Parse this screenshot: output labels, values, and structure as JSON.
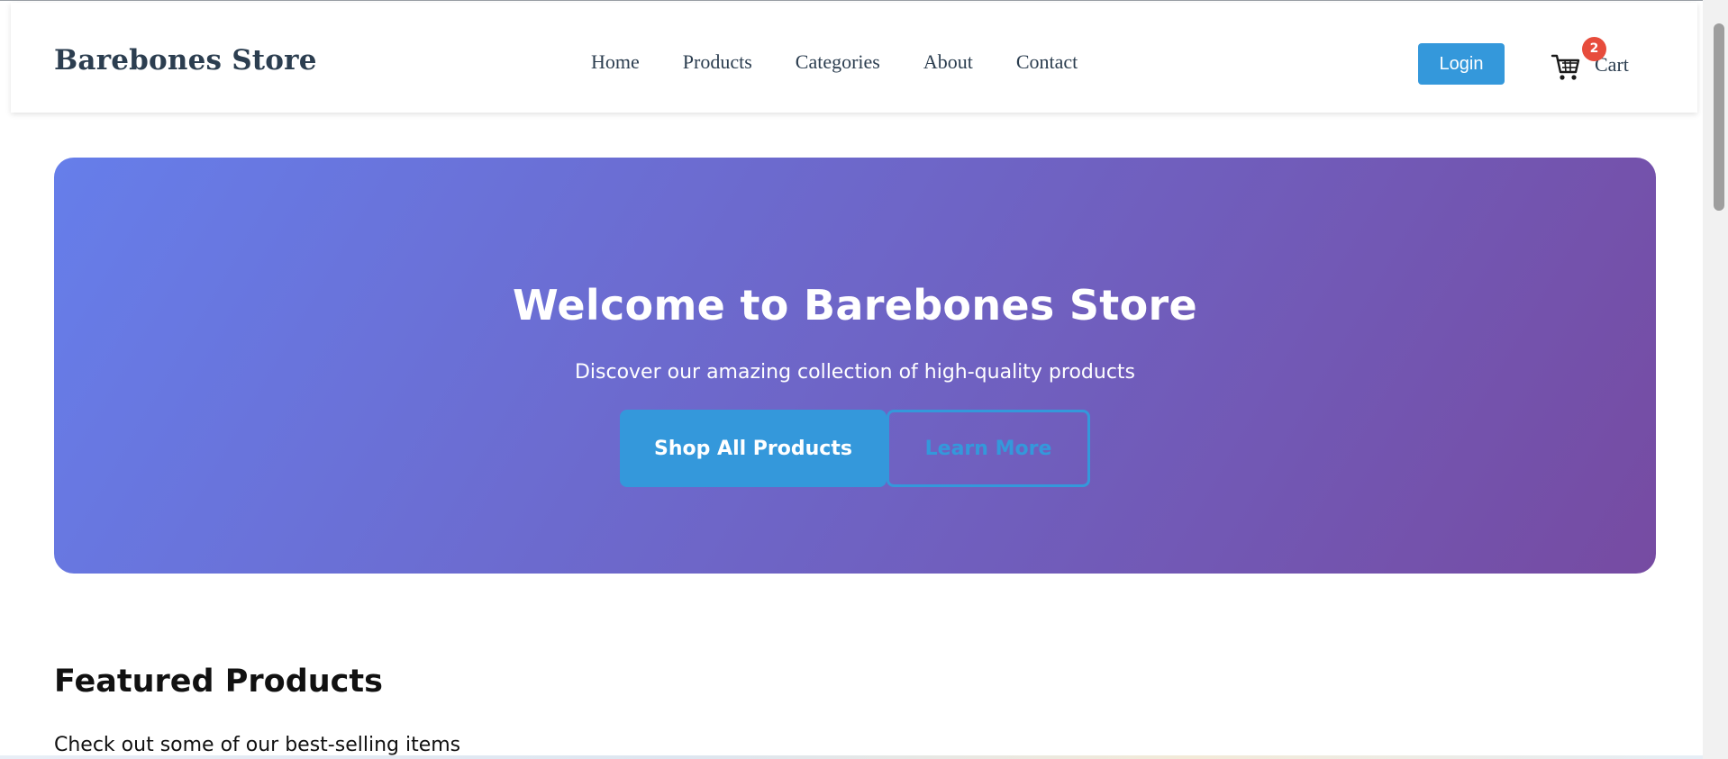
{
  "header": {
    "logo": "Barebones Store",
    "nav": [
      {
        "label": "Home"
      },
      {
        "label": "Products"
      },
      {
        "label": "Categories"
      },
      {
        "label": "About"
      },
      {
        "label": "Contact"
      }
    ],
    "login_label": "Login",
    "cart_label": "Cart",
    "cart_count": "2",
    "cart_icon": "shopping-cart-icon"
  },
  "hero": {
    "title": "Welcome to Barebones Store",
    "subtitle": "Discover our amazing collection of high-quality products",
    "primary_button": "Shop All Products",
    "secondary_button": "Learn More"
  },
  "featured": {
    "title": "Featured Products",
    "subtitle": "Check out some of our best-selling items"
  },
  "colors": {
    "accent": "#3498db",
    "badge": "#e74c3c",
    "hero_gradient_start": "#667eea",
    "hero_gradient_end": "#764ba2",
    "text_dark": "#2c3e50"
  }
}
